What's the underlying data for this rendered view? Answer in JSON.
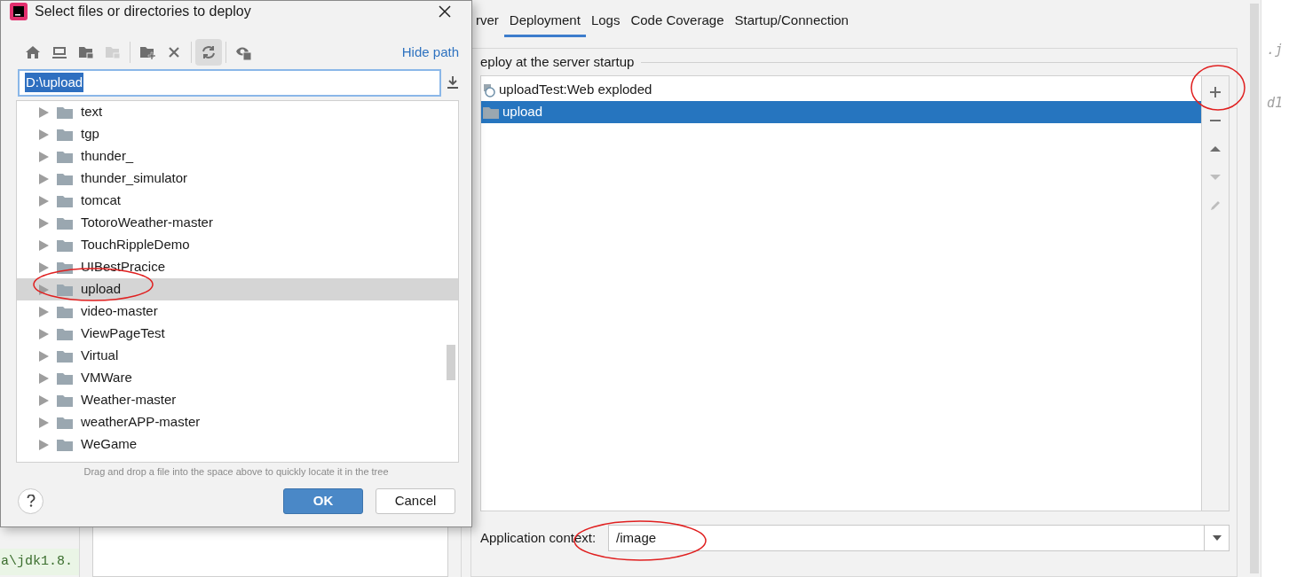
{
  "dialog": {
    "title": "Select files or directories to deploy",
    "toolbar_groups": [
      [
        {
          "kind": "home",
          "disabled": false,
          "pressed": false
        },
        {
          "kind": "desktop",
          "disabled": false,
          "pressed": false
        },
        {
          "kind": "module",
          "disabled": false,
          "pressed": false
        },
        {
          "kind": "module",
          "disabled": true,
          "pressed": false
        }
      ],
      [
        {
          "kind": "new-folder",
          "disabled": false,
          "pressed": false
        },
        {
          "kind": "delete",
          "disabled": false,
          "pressed": false
        }
      ],
      [
        {
          "kind": "refresh",
          "disabled": false,
          "pressed": true
        }
      ],
      [
        {
          "kind": "hidden-files",
          "disabled": false,
          "pressed": false
        }
      ]
    ],
    "hide_path": "Hide path",
    "path": "D:\\upload",
    "tree": [
      {
        "label": "text",
        "selected": false
      },
      {
        "label": "tgp",
        "selected": false
      },
      {
        "label": "thunder_",
        "selected": false
      },
      {
        "label": "thunder_simulator",
        "selected": false
      },
      {
        "label": "tomcat",
        "selected": false
      },
      {
        "label": "TotoroWeather-master",
        "selected": false
      },
      {
        "label": "TouchRippleDemo",
        "selected": false
      },
      {
        "label": "UIBestPracice",
        "selected": false
      },
      {
        "label": "upload",
        "selected": true
      },
      {
        "label": "video-master",
        "selected": false
      },
      {
        "label": "ViewPageTest",
        "selected": false
      },
      {
        "label": "Virtual",
        "selected": false
      },
      {
        "label": "VMWare",
        "selected": false
      },
      {
        "label": "Weather-master",
        "selected": false
      },
      {
        "label": "weatherAPP-master",
        "selected": false
      },
      {
        "label": "WeGame",
        "selected": false
      }
    ],
    "hint": "Drag and drop a file into the space above to quickly locate it in the tree",
    "buttons": [
      {
        "label": "OK",
        "kind": "primary"
      },
      {
        "label": "Cancel",
        "kind": "secondary"
      }
    ]
  },
  "run_config": {
    "tabs": [
      {
        "label": "rver",
        "selected": false
      },
      {
        "label": "Deployment",
        "selected": true
      },
      {
        "label": "Logs",
        "selected": false
      },
      {
        "label": "Code Coverage",
        "selected": false
      },
      {
        "label": "Startup/Connection",
        "selected": false
      }
    ],
    "section_title": "eploy at the server startup",
    "deployments": [
      {
        "label": "uploadTest:Web exploded",
        "kind": "artifact",
        "selected": false
      },
      {
        "label": "upload",
        "kind": "folder",
        "selected": true
      }
    ],
    "side_tools": [
      {
        "kind": "add",
        "disabled": false
      },
      {
        "kind": "remove",
        "disabled": false
      },
      {
        "kind": "up",
        "disabled": false
      },
      {
        "kind": "down",
        "disabled": true
      },
      {
        "kind": "edit",
        "disabled": true
      }
    ],
    "context_label": "Application context:",
    "context_value": "/image"
  },
  "console_text": "a\\jdk1.8.",
  "editor_fragments": [
    ".j",
    "d1"
  ]
}
